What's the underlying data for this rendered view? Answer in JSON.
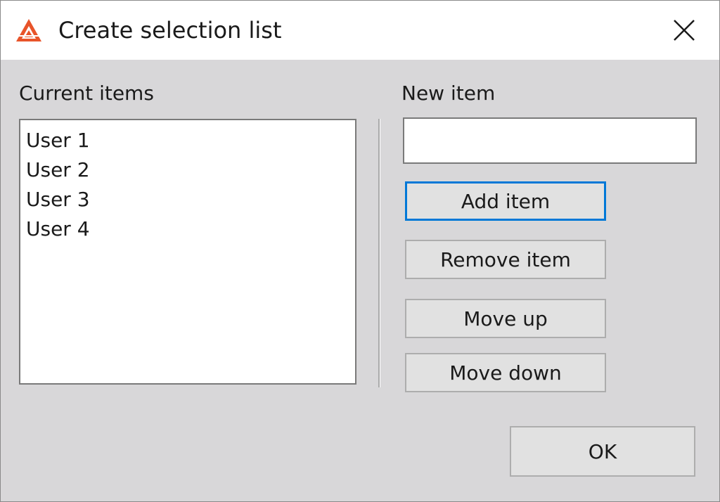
{
  "window": {
    "title": "Create selection list",
    "accent_color": "#0078d7",
    "icon_color": "#e8542a"
  },
  "current_items": {
    "label": "Current items",
    "items": [
      "User 1",
      "User 2",
      "User 3",
      "User 4"
    ]
  },
  "new_item": {
    "label": "New item",
    "value": ""
  },
  "buttons": {
    "add_item": "Add item",
    "remove_item": "Remove item",
    "move_up": "Move up",
    "move_down": "Move down",
    "ok": "OK"
  }
}
